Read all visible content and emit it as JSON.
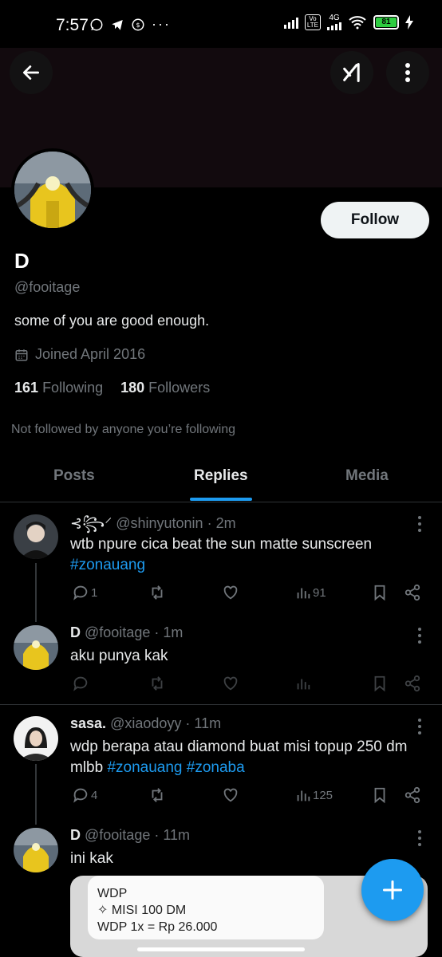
{
  "status_bar": {
    "time": "7:57",
    "network": "4G",
    "battery": "81"
  },
  "profile": {
    "name": "D",
    "handle": "@fooitage",
    "bio": "some of you are good enough.",
    "joined": "Joined April 2016",
    "following_count": "161",
    "following_label": "Following",
    "followers_count": "180",
    "followers_label": "Followers",
    "not_followed": "Not followed by anyone you’re following",
    "follow_label": "Follow"
  },
  "tabs": [
    {
      "label": "Posts",
      "active": false
    },
    {
      "label": "Replies",
      "active": true
    },
    {
      "label": "Media",
      "active": false
    }
  ],
  "tweets": [
    {
      "name": "⊰꧂⸍",
      "handle": "@shinyutonin",
      "time": "· 2m",
      "text": "wtb npure cica beat the sun matte sunscreen",
      "hashtags": "#zonauang",
      "replies": "1",
      "views": "91"
    },
    {
      "name": "D",
      "handle": "@fooitage",
      "time": "· 1m",
      "text": "aku punya kak"
    },
    {
      "name": "sasa.",
      "handle": "@xiaodoyy",
      "time": "· 11m",
      "text": "wdp berapa atau diamond buat misi topup 250 dm",
      "text2": "mlbb",
      "hashtags": "#zonauang #zonaba",
      "replies": "4",
      "views": "125"
    },
    {
      "name": "D",
      "handle": "@fooitage",
      "time": "· 11m",
      "text": "ini kak",
      "media": {
        "line1": "WDP",
        "line2": "✧ MISI 100 DM",
        "line3": "WDP 1x = Rp 26.000"
      }
    }
  ],
  "colors": {
    "accent": "#1d9bf0",
    "background": "#000000",
    "muted": "#71767b"
  }
}
